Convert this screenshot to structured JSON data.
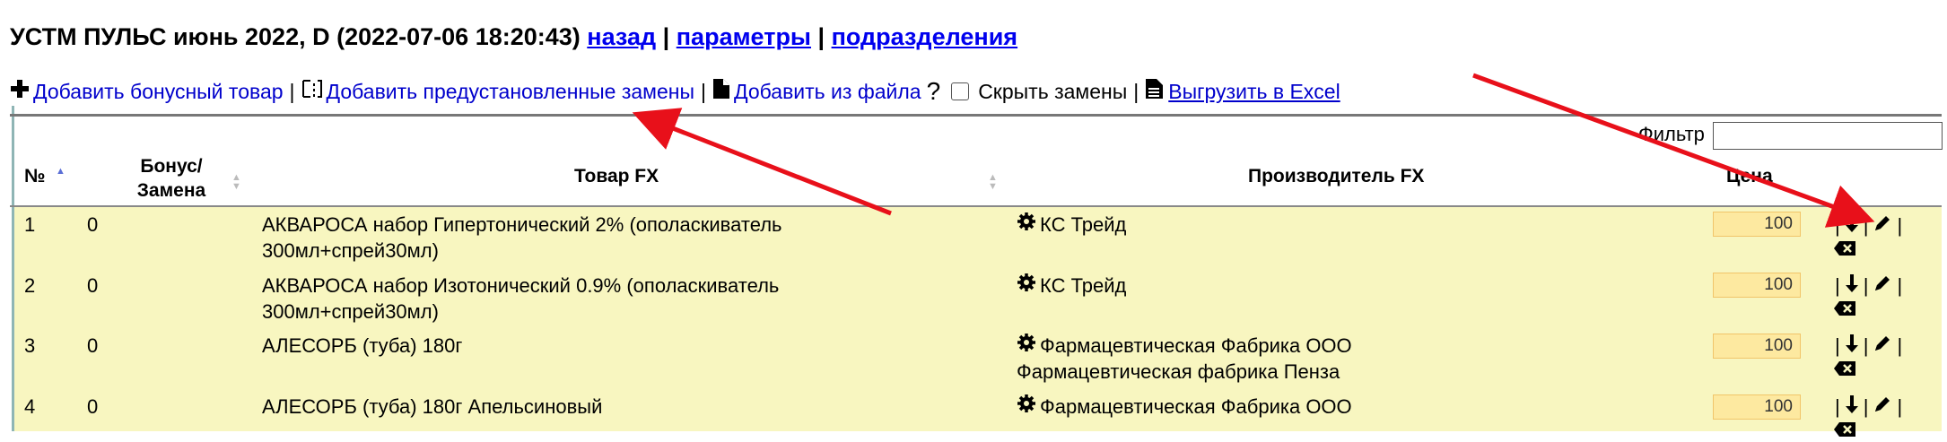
{
  "header": {
    "title": "УСТМ ПУЛЬС июнь 2022, D (2022-07-06 18:20:43)",
    "links": [
      "назад",
      "параметры",
      "подразделения"
    ],
    "sep": "|"
  },
  "toolbar": {
    "add_bonus": "Добавить бонусный товар",
    "add_preset": "Добавить предустановленные замены",
    "add_file": "Добавить из файла",
    "help": "?",
    "hide_replacements": "Скрыть замены",
    "export_excel": "Выгрузить в Excel",
    "pipe": "|"
  },
  "filter": {
    "label": "Фильтр",
    "value": ""
  },
  "columns": {
    "num": "№",
    "bonus_line1": "Бонус/",
    "bonus_line2": "Замена",
    "product": "Товар FX",
    "manufacturer": "Производитель FX",
    "price": "Цена"
  },
  "rows": [
    {
      "num": "1",
      "bonus": "0",
      "product1": "АКВАРОСА набор Гипертонический 2% (ополаскиватель",
      "product2": "300мл+спрей30мл)",
      "maker1": "КС Трейд",
      "maker2": "",
      "price": "100"
    },
    {
      "num": "2",
      "bonus": "0",
      "product1": "АКВАРОСА набор Изотонический 0.9% (ополаскиватель",
      "product2": "300мл+спрей30мл)",
      "maker1": "КС Трейд",
      "maker2": "",
      "price": "100"
    },
    {
      "num": "3",
      "bonus": "0",
      "product1": "АЛЕСОРБ (туба) 180г",
      "product2": "",
      "maker1": "Фармацевтическая Фабрика ООО",
      "maker2": "Фармацевтическая фабрика Пенза",
      "price": "100"
    },
    {
      "num": "4",
      "bonus": "0",
      "product1": "АЛЕСОРБ (туба) 180г Апельсиновый",
      "product2": "",
      "maker1": "Фармацевтическая Фабрика ООО",
      "maker2": "",
      "price": "100"
    }
  ],
  "colors": {
    "link": "#0000ee",
    "row_bg": "#f8f6c0",
    "price_bg": "#fde9a0",
    "arrow": "#e8101a"
  }
}
